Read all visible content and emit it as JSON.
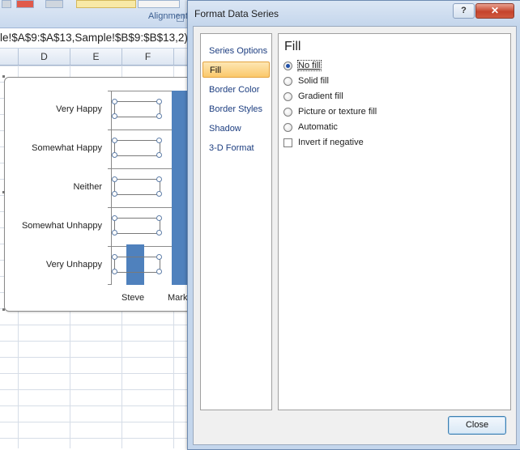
{
  "excel": {
    "ribbon_group": "Alignment",
    "formula_text": "le!$A$9:$A$13,Sample!$B$9:$B$13,2)",
    "columns": [
      "D",
      "E",
      "F"
    ]
  },
  "chart": {
    "categories": [
      "Very Happy",
      "Somewhat Happy",
      "Neither",
      "Somewhat Unhappy",
      "Very Unhappy"
    ],
    "series_labels": [
      "Steve",
      "Mark"
    ],
    "bar_color": "#4f81bd"
  },
  "dialog": {
    "title": "Format Data Series",
    "help_glyph": "?",
    "close_glyph": "✕",
    "nav": [
      "Series Options",
      "Fill",
      "Border Color",
      "Border Styles",
      "Shadow",
      "3-D Format"
    ],
    "active_nav": "Fill",
    "section_title": "Fill",
    "options": [
      "No fill",
      "Solid fill",
      "Gradient fill",
      "Picture or texture fill",
      "Automatic"
    ],
    "selected_option": "No fill",
    "checkbox_label": "Invert if negative",
    "checkbox_checked": false,
    "close_label": "Close"
  }
}
